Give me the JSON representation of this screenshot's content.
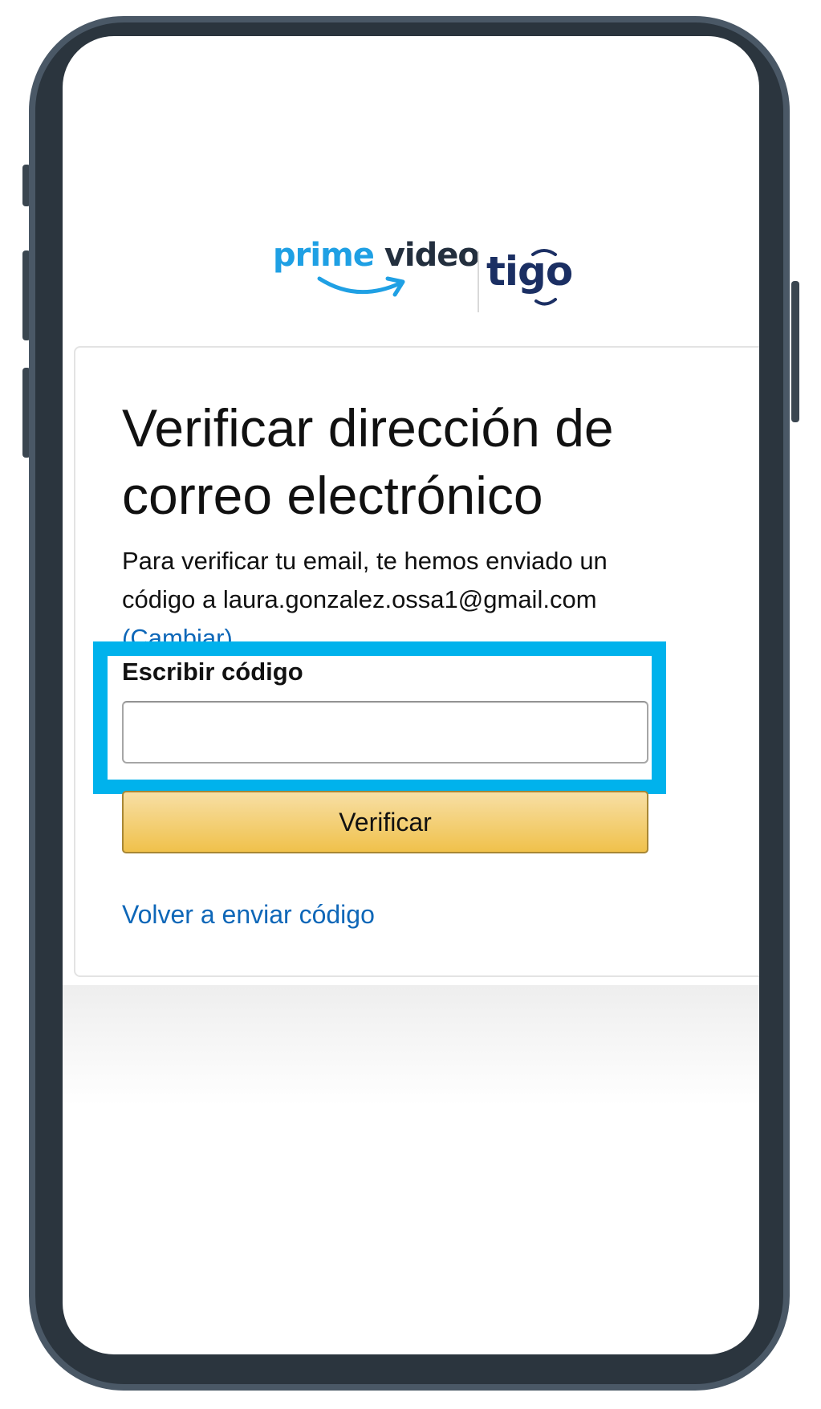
{
  "branding": {
    "prime_word": "prime",
    "video_word": "video",
    "partner": "tigo",
    "prime_color": "#1fa0e4",
    "partner_color": "#1b2f63"
  },
  "card": {
    "title": "Verificar dirección de correo electrónico",
    "description": "Para verificar tu email, te hemos enviado un código a laura.gonzalez.ossa1@gmail.com",
    "change_link": "(Cambiar)",
    "code_label": "Escribir código",
    "code_value": "",
    "verify_button": "Verificar",
    "resend_link": "Volver a enviar código"
  },
  "colors": {
    "highlight": "#00b2ec",
    "button": "#f0c14b",
    "link": "#0e67b8"
  }
}
